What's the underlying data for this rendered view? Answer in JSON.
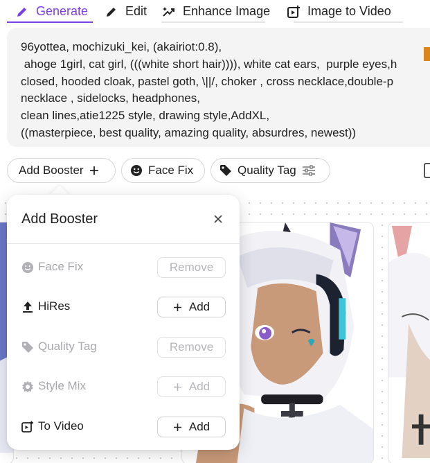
{
  "tabs": [
    {
      "label": "Generate",
      "icon": "pencil-icon",
      "active": true
    },
    {
      "label": "Edit",
      "icon": "pencil-icon",
      "active": false
    },
    {
      "label": "Enhance Image",
      "icon": "enhance-icon",
      "active": false
    },
    {
      "label": "Image to Video",
      "icon": "image-to-video-icon",
      "active": false
    }
  ],
  "prompt": {
    "line1": "96yottea, mochizuki_kei, (akairiot:0.8),",
    "line2": " ahoge 1girl, cat girl, (((white short hair)))), white cat ears,  purple eyes,h",
    "line3": "closed, hooded cloak, pastel goth, \\||/, choker , cross necklace,double-p",
    "line4": "necklace , sidelocks, headphones,",
    "line5": "clean lines,atie1225 style, drawing style,AddXL,",
    "line6": "((masterpiece, best quality, amazing quality, absurdres, newest))"
  },
  "chips": {
    "add_booster": "Add Booster",
    "add_booster_icon": "plus-icon",
    "face_fix": "Face Fix",
    "face_fix_icon": "smiley-icon",
    "quality_tag": "Quality Tag",
    "quality_tag_icon": "tag-icon",
    "quality_tag_trailing_icon": "sliders-icon"
  },
  "popover": {
    "title": "Add Booster",
    "close_icon": "close-icon",
    "rows": [
      {
        "label": "Face Fix",
        "icon": "smiley-icon",
        "action": "Remove",
        "disabled": true
      },
      {
        "label": "HiRes",
        "icon": "upload-icon",
        "action": "Add",
        "disabled": false
      },
      {
        "label": "Quality Tag",
        "icon": "tag-icon",
        "action": "Remove",
        "disabled": true
      },
      {
        "label": "Style Mix",
        "icon": "style-mix-icon",
        "action": "Add",
        "disabled": true
      },
      {
        "label": "To Video",
        "icon": "image-to-video-icon",
        "action": "Add",
        "disabled": false
      }
    ]
  },
  "colors": {
    "accent": "#7b3fe4",
    "prompt_bg": "#f4f4f5",
    "text": "#1f1f1f",
    "disabled_text": "#a8a8ad"
  }
}
